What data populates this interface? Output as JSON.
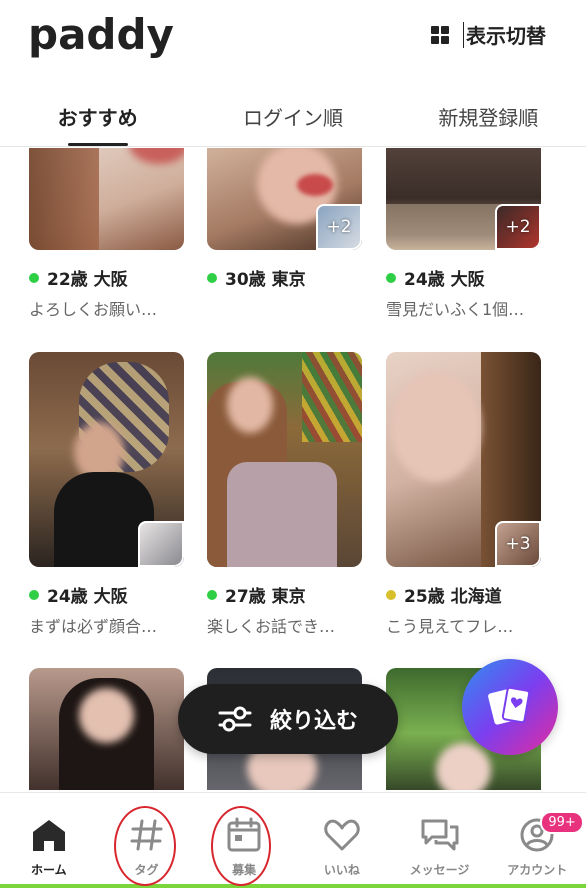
{
  "header": {
    "logo": "paddy",
    "view_toggle_label": "表示切替"
  },
  "tabs": [
    {
      "label": "おすすめ",
      "active": true
    },
    {
      "label": "ログイン順",
      "active": false
    },
    {
      "label": "新規登録順",
      "active": false
    }
  ],
  "profiles": [
    {
      "age_city": "22歳 大阪",
      "bio": "よろしくお願い…",
      "online_color": "#2fcf45",
      "more": ""
    },
    {
      "age_city": "30歳 東京",
      "bio": "",
      "online_color": "#2fcf45",
      "more": "+2"
    },
    {
      "age_city": "24歳 大阪",
      "bio": "雪見だいふく1個…",
      "online_color": "#2fcf45",
      "more": "+2"
    },
    {
      "age_city": "24歳 大阪",
      "bio": "まずは必ず顔合…",
      "online_color": "#2fcf45",
      "more": ""
    },
    {
      "age_city": "27歳 東京",
      "bio": "楽しくお話でき…",
      "online_color": "#2fcf45",
      "more": ""
    },
    {
      "age_city": "25歳 北海道",
      "bio": "こう見えてフレ…",
      "online_color": "#d8c02a",
      "more": "+3"
    }
  ],
  "filter_button": {
    "label": "絞り込む"
  },
  "bottom_nav": [
    {
      "label": "ホーム",
      "icon": "home-icon",
      "active": true
    },
    {
      "label": "タグ",
      "icon": "hashtag-icon",
      "active": false
    },
    {
      "label": "募集",
      "icon": "calendar-icon",
      "active": false
    },
    {
      "label": "いいね",
      "icon": "heart-icon",
      "active": false
    },
    {
      "label": "メッセージ",
      "icon": "chat-icon",
      "active": false
    },
    {
      "label": "アカウント",
      "icon": "account-icon",
      "active": false
    }
  ],
  "account_badge": "99+",
  "colors": {
    "online": "#2fcf45",
    "away": "#d8c02a",
    "badge": "#e8327e",
    "annotation": "#d8262e"
  }
}
